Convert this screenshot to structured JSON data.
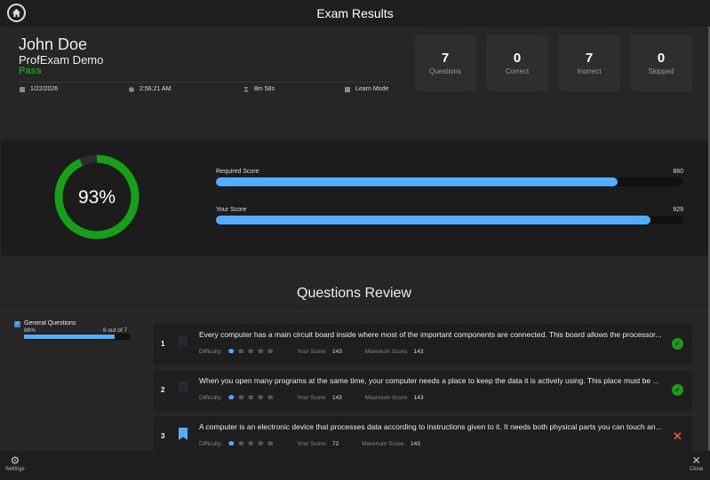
{
  "title": "Exam Results",
  "user": {
    "name": "John Doe",
    "exam": "ProfExam Demo",
    "result": "Pass"
  },
  "meta": {
    "date": "1/22/2026",
    "time": "2:56:21 AM",
    "duration": "8m 58s",
    "mode": "Learn Mode"
  },
  "stats": [
    {
      "value": "7",
      "label": "Questions"
    },
    {
      "value": "0",
      "label": "Correct"
    },
    {
      "value": "7",
      "label": "Inorrect"
    },
    {
      "value": "0",
      "label": "Skipped"
    }
  ],
  "score": {
    "percent_label": "93%",
    "percent": 93,
    "required_label": "Required Score",
    "required": "860",
    "required_value": 860,
    "your_label": "Your Score",
    "your": "929",
    "your_value": 929,
    "max": 1000,
    "colors": {
      "ring": "#16a016",
      "bar": "#52adff"
    }
  },
  "review": {
    "title": "Questions Review",
    "category": {
      "name": "General Questions",
      "percent": "86%",
      "count": "6 out of 7",
      "fraction": 0.86
    },
    "labels": {
      "difficulty": "Difficulty:",
      "your_score": "Your Score:",
      "max_score": "Maximum Score:"
    },
    "questions": [
      {
        "num": "1",
        "text": "Every computer has a main circuit board inside where most of the important components are connected. This board allows the processor...",
        "your": "143",
        "max": "143",
        "status": "correct",
        "bookmarked": false,
        "difficulty": 1
      },
      {
        "num": "2",
        "text": "When you open many programs at the same time, your computer needs a place to keep the data it is actively using. This place must be ...",
        "your": "143",
        "max": "143",
        "status": "correct",
        "bookmarked": false,
        "difficulty": 1
      },
      {
        "num": "3",
        "text": "A computer is an electronic device that processes data according to instructions given to it. It needs both physical parts you can touch an...",
        "your": "72",
        "max": "143",
        "status": "incorrect",
        "bookmarked": true,
        "difficulty": 1
      }
    ]
  },
  "footer": {
    "settings": "Settings",
    "close": "Close"
  }
}
